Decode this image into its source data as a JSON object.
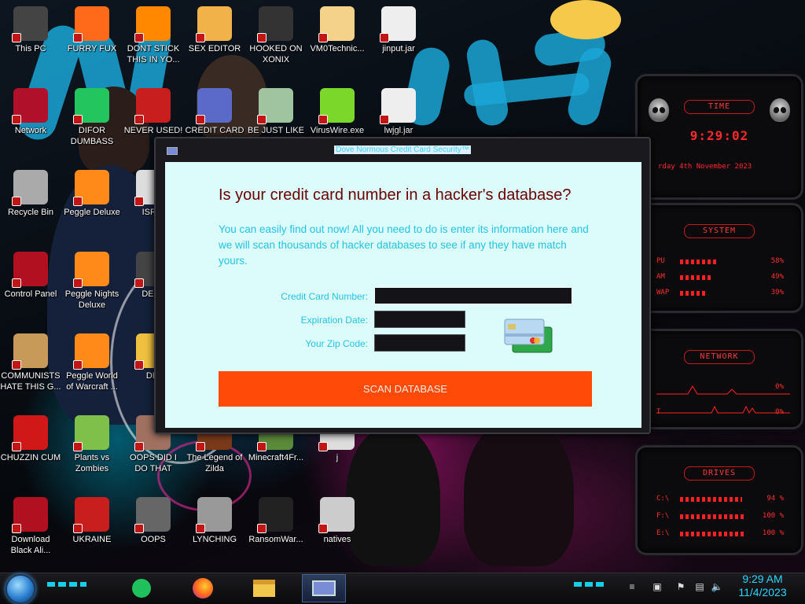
{
  "desktop": {
    "icons": [
      {
        "label": "This PC",
        "glyph": "pc-icon"
      },
      {
        "label": "FURRY FUX",
        "glyph": "firefox-icon"
      },
      {
        "label": "DONT STICK THIS IN YO...",
        "glyph": "vlc-cone-icon"
      },
      {
        "label": "SEX EDITOR",
        "glyph": "hxd-icon"
      },
      {
        "label": "HOOKED ON XONIX",
        "glyph": "xonix-icon"
      },
      {
        "label": "VM0Technic...",
        "glyph": "doctor-icon"
      },
      {
        "label": "jinput.jar",
        "glyph": "java-icon"
      },
      {
        "label": "Network",
        "glyph": "network-icon"
      },
      {
        "label": "DIFOR DUMBASS",
        "glyph": "discord-green-icon"
      },
      {
        "label": "NEVER USED!",
        "glyph": "devcpp-icon"
      },
      {
        "label": "CREDIT CARD",
        "glyph": "credit-card-icon"
      },
      {
        "label": "BE JUST LIKE",
        "glyph": "santa-icon"
      },
      {
        "label": "VirusWire.exe",
        "glyph": "limewire-icon"
      },
      {
        "label": "lwjgl.jar",
        "glyph": "java-icon"
      },
      {
        "label": "Recycle Bin",
        "glyph": "recycle-bin-icon"
      },
      {
        "label": "Peggle Deluxe",
        "glyph": "peggle-icon"
      },
      {
        "label": "ISRAI",
        "glyph": "flag-icon"
      },
      {
        "label": "Control Panel",
        "glyph": "control-panel-icon"
      },
      {
        "label": "Peggle Nights Deluxe",
        "glyph": "peggle-nights-icon"
      },
      {
        "label": "DEEZ",
        "glyph": "generic-icon"
      },
      {
        "label": "COMMUNISTS HATE THIS G...",
        "glyph": "money-bag-icon"
      },
      {
        "label": "Peggle World of Warcraft ...",
        "glyph": "peggle-wow-icon"
      },
      {
        "label": "DIE",
        "glyph": "generic-icon"
      },
      {
        "label": "CHUZZIN CUM",
        "glyph": "chuzzle-icon"
      },
      {
        "label": "Plants vs Zombies",
        "glyph": "pvz-icon"
      },
      {
        "label": "OOPS DID I DO THAT",
        "glyph": "portrait-icon"
      },
      {
        "label": "The Legend of Zilda",
        "glyph": "zelda-icon"
      },
      {
        "label": "Minecraft4Fr...",
        "glyph": "minecraft-icon"
      },
      {
        "label": "j",
        "glyph": "generic-icon"
      },
      {
        "label": "Download Black Ali...",
        "glyph": "black-alien-icon"
      },
      {
        "label": "UKRAINE",
        "glyph": "radiation-icon"
      },
      {
        "label": "OOPS",
        "glyph": "oops-icon"
      },
      {
        "label": "LYNCHING",
        "glyph": "noose-icon"
      },
      {
        "label": "RansomWar...",
        "glyph": "skull-icon"
      },
      {
        "label": "natives",
        "glyph": "folder-file-icon"
      }
    ]
  },
  "gadget": {
    "time": {
      "title": "TIME",
      "clock": "9:29:02",
      "date": "rday 4th November 2023"
    },
    "system": {
      "title": "SYSTEM",
      "rows": [
        {
          "label": "PU",
          "value": "58%",
          "level": 0.58
        },
        {
          "label": "AM",
          "value": "49%",
          "level": 0.49
        },
        {
          "label": "WAP",
          "value": "39%",
          "level": 0.39
        }
      ]
    },
    "network": {
      "title": "NETWORK",
      "rows": [
        {
          "label": "",
          "value": "0%"
        },
        {
          "label": "T",
          "value": "0%"
        }
      ]
    },
    "drives": {
      "title": "DRIVES",
      "rows": [
        {
          "label": "C:\\",
          "value": "94 %",
          "level": 0.94
        },
        {
          "label": "F:\\",
          "value": "100 %",
          "level": 1.0
        },
        {
          "label": "E:\\",
          "value": "100 %",
          "level": 1.0
        }
      ]
    }
  },
  "dialog": {
    "title": "Dove Normous Credit Card Security™",
    "headline": "Is your credit card number in a hacker's database?",
    "intro": "You can easily find out now! All you need to do is enter its information here and we will scan thousands of hacker databases to see if any they have match yours.",
    "fields": {
      "card_number_label": "Credit Card Number:",
      "card_number_value": "",
      "expiration_label": "Expiration Date:",
      "expiration_value": "",
      "zip_label": "Your Zip Code:",
      "zip_value": ""
    },
    "scan_button": "SCAN DATABASE",
    "colors": {
      "headline": "#6b0000",
      "text": "#22c4e6",
      "button": "#ff4a08",
      "background": "#dcfbfb"
    }
  },
  "taskbar": {
    "pinned": [
      "green-app-icon",
      "firefox-icon",
      "file-explorer-icon",
      "credit-card-app-icon"
    ],
    "tray": [
      "tray-chevron-icon",
      "monitor-icon",
      "flag-icon",
      "network-icon",
      "volume-icon"
    ],
    "clock": {
      "time": "9:29 AM",
      "date": "11/4/2023"
    }
  }
}
